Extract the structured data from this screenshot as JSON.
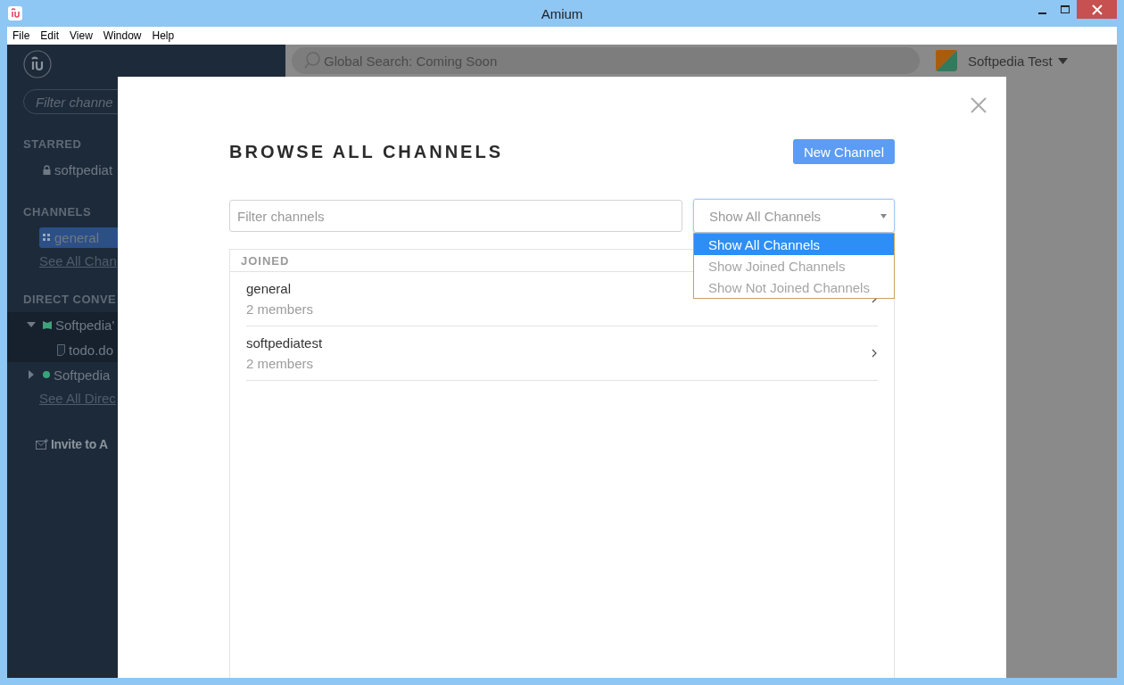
{
  "window": {
    "title": "Amium"
  },
  "menu": [
    "File",
    "Edit",
    "View",
    "Window",
    "Help"
  ],
  "sidebar": {
    "filter_placeholder": "Filter channe",
    "sections": [
      {
        "title": "STARRED",
        "items": [
          {
            "kind": "private",
            "label": "softpediat",
            "selected": false
          }
        ]
      },
      {
        "title": "CHANNELS",
        "items": [
          {
            "kind": "channel",
            "label": "general",
            "selected": true
          }
        ],
        "link": "See All Chan"
      },
      {
        "title": "DIRECT CONVE",
        "items": [
          {
            "kind": "group",
            "label": "Softpedia'",
            "selected": false,
            "expanded": true,
            "color": "#3aa37a",
            "children": [
              {
                "kind": "file",
                "label": "todo.do",
                "selected": false
              }
            ]
          },
          {
            "kind": "person",
            "label": "Softpedia",
            "selected": false,
            "expanded": false,
            "color": "#3aa37a"
          }
        ],
        "link": "See All Direc"
      }
    ],
    "invite": "Invite to A"
  },
  "topbar": {
    "search_placeholder": "Global Search: Coming Soon",
    "user": "Softpedia Test"
  },
  "modal": {
    "title": "BROWSE ALL CHANNELS",
    "new_button": "New Channel",
    "filter_placeholder": "Filter channels",
    "select": {
      "value": "Show All Channels",
      "open": true,
      "options": [
        {
          "label": "Show All Channels",
          "selected": true
        },
        {
          "label": "Show Joined Channels",
          "selected": false
        },
        {
          "label": "Show Not Joined Channels",
          "selected": false
        }
      ]
    },
    "groups": [
      {
        "title": "JOINED",
        "channels": [
          {
            "name": "general",
            "members": "2 members"
          },
          {
            "name": "softpediatest",
            "members": "2 members"
          }
        ]
      }
    ]
  }
}
